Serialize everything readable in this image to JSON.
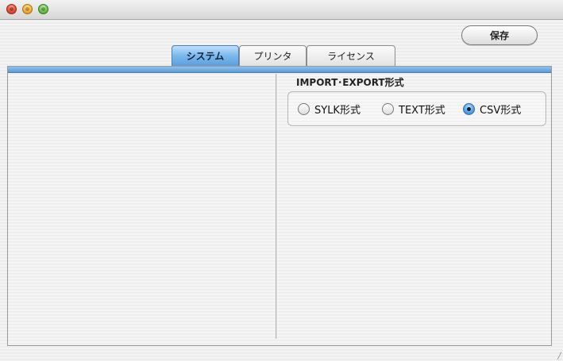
{
  "window": {
    "traffic_lights": [
      {
        "name": "close",
        "color": "#e84b34"
      },
      {
        "name": "minimize",
        "color": "#f2b33a"
      },
      {
        "name": "zoom",
        "color": "#6fc34a"
      }
    ]
  },
  "toolbar": {
    "save_label": "保存"
  },
  "tabs": [
    {
      "label": "システム",
      "active": true
    },
    {
      "label": "プリンタ",
      "active": false
    },
    {
      "label": "ライセンス",
      "active": false
    }
  ],
  "import_export": {
    "title": "IMPORT･EXPORT形式",
    "options": [
      {
        "label": "SYLK形式",
        "selected": false
      },
      {
        "label": "TEXT形式",
        "selected": false
      },
      {
        "label": "CSV形式",
        "selected": true
      }
    ]
  },
  "colors": {
    "tab_active": "#7ab7ec",
    "panel_bar": "#5c9bd6"
  }
}
